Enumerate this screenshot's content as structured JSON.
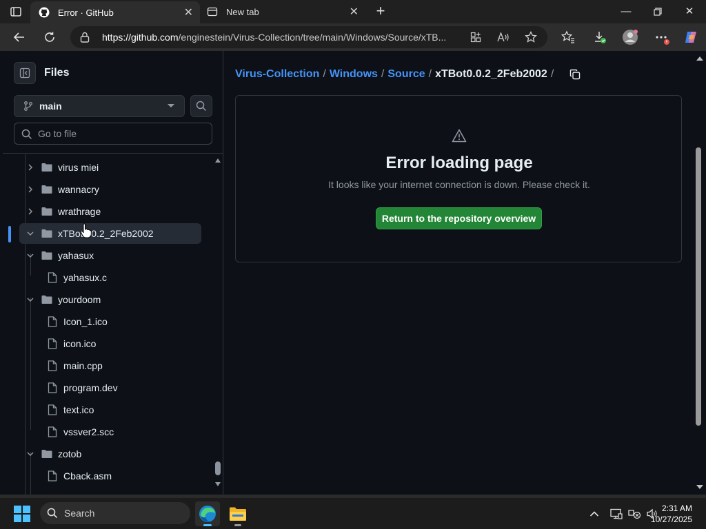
{
  "browser": {
    "tabs": [
      {
        "label": "Error · GitHub",
        "active": true
      },
      {
        "label": "New tab",
        "active": false
      }
    ],
    "url_host": "https://github.com",
    "url_path": "/enginestein/Virus-Collection/tree/main/Windows/Source/xTB..."
  },
  "sidebar": {
    "title": "Files",
    "branch": "main",
    "goto_placeholder": "Go to file",
    "items": [
      {
        "label": "virus miei",
        "type": "folder",
        "expanded": false
      },
      {
        "label": "wannacry",
        "type": "folder",
        "expanded": false
      },
      {
        "label": "wrathrage",
        "type": "folder",
        "expanded": false
      },
      {
        "label": "xTBot0.0.2_2Feb2002",
        "type": "folder",
        "expanded": true,
        "selected": true
      },
      {
        "label": "yahasux",
        "type": "folder",
        "expanded": true
      },
      {
        "label": "yahasux.c",
        "type": "file"
      },
      {
        "label": "yourdoom",
        "type": "folder",
        "expanded": true
      },
      {
        "label": "Icon_1.ico",
        "type": "file"
      },
      {
        "label": "icon.ico",
        "type": "file"
      },
      {
        "label": "main.cpp",
        "type": "file"
      },
      {
        "label": "program.dev",
        "type": "file"
      },
      {
        "label": "text.ico",
        "type": "file"
      },
      {
        "label": "vssver2.scc",
        "type": "file"
      },
      {
        "label": "zotob",
        "type": "folder",
        "expanded": true
      },
      {
        "label": "Cback.asm",
        "type": "file"
      }
    ]
  },
  "main": {
    "breadcrumb": {
      "repo": "Virus-Collection",
      "dir1": "Windows",
      "dir2": "Source",
      "current": "xTBot0.0.2_2Feb2002",
      "separator": "/"
    },
    "error": {
      "icon": "alert-icon",
      "title": "Error loading page",
      "message": "It looks like your internet connection is down. Please check it.",
      "button_label": "Return to the repository overview"
    }
  },
  "taskbar": {
    "search_placeholder": "Search",
    "time": "2:31 AM",
    "date": "10/27/2025"
  },
  "colors": {
    "accent": "#4493f8",
    "button_green": "#238636",
    "background": "#0d1117"
  }
}
